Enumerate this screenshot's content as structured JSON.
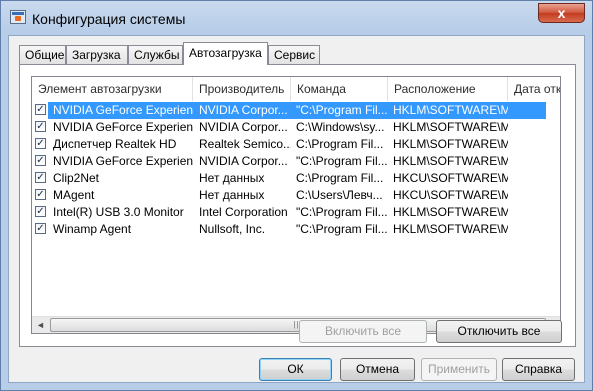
{
  "window": {
    "title": "Конфигурация системы",
    "close_glyph": "x"
  },
  "tabs": [
    {
      "label": "Общие"
    },
    {
      "label": "Загрузка"
    },
    {
      "label": "Службы"
    },
    {
      "label": "Автозагрузка"
    },
    {
      "label": "Сервис"
    }
  ],
  "active_tab": "Автозагрузка",
  "table": {
    "columns": [
      "Элемент автозагрузки",
      "Производитель",
      "Команда",
      "Расположение",
      "Дата отк"
    ],
    "rows": [
      {
        "checked": true,
        "name": "NVIDIA GeForce Experience",
        "vendor": "NVIDIA Corpor...",
        "command": "\"C:\\Program Fil...",
        "location": "HKLM\\SOFTWARE\\M...",
        "selected": true
      },
      {
        "checked": true,
        "name": "NVIDIA GeForce Experience",
        "vendor": "NVIDIA Corpor...",
        "command": "C:\\Windows\\sy...",
        "location": "HKLM\\SOFTWARE\\M...",
        "selected": false
      },
      {
        "checked": true,
        "name": "Диспетчер Realtek HD",
        "vendor": "Realtek Semico...",
        "command": "C:\\Program Fil...",
        "location": "HKLM\\SOFTWARE\\M...",
        "selected": false
      },
      {
        "checked": true,
        "name": "NVIDIA GeForce Experience",
        "vendor": "NVIDIA Corpor...",
        "command": "\"C:\\Program Fil...",
        "location": "HKLM\\SOFTWARE\\M...",
        "selected": false
      },
      {
        "checked": true,
        "name": "Clip2Net",
        "vendor": "Нет данных",
        "command": "C:\\Program Fil...",
        "location": "HKCU\\SOFTWARE\\M...",
        "selected": false
      },
      {
        "checked": true,
        "name": "MAgent",
        "vendor": "Нет данных",
        "command": "C:\\Users\\Левч...",
        "location": "HKCU\\SOFTWARE\\M...",
        "selected": false
      },
      {
        "checked": true,
        "name": "Intel(R) USB 3.0 Monitor",
        "vendor": "Intel Corporation",
        "command": "\"C:\\Program Fil...",
        "location": "HKLM\\SOFTWARE\\M...",
        "selected": false
      },
      {
        "checked": true,
        "name": "Winamp Agent",
        "vendor": "Nullsoft, Inc.",
        "command": "\"C:\\Program Fil...",
        "location": "HKLM\\SOFTWARE\\M...",
        "selected": false
      }
    ]
  },
  "scrollbar": {
    "left_arrow": "◄",
    "right_arrow": "►",
    "grip": "|||"
  },
  "checkbox_glyph": "✓",
  "buttons": {
    "enable_all": "Включить все",
    "disable_all": "Отключить все",
    "ok": "ОК",
    "cancel": "Отмена",
    "apply": "Применить",
    "help": "Справка"
  },
  "colors": {
    "selection": "#3399ff",
    "window_frame": "#b7cde8",
    "close_button": "#c7432a"
  }
}
